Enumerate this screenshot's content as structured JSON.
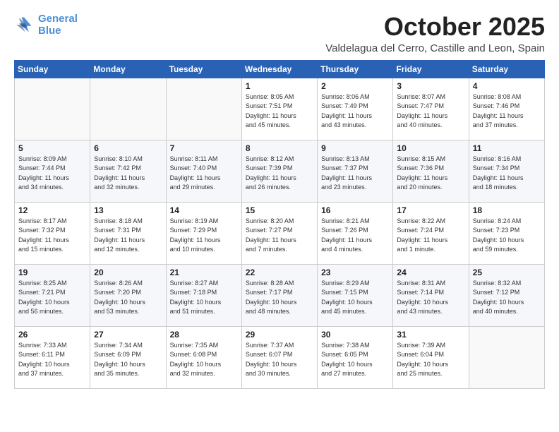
{
  "header": {
    "logo_line1": "General",
    "logo_line2": "Blue",
    "month": "October 2025",
    "location": "Valdelagua del Cerro, Castille and Leon, Spain"
  },
  "weekdays": [
    "Sunday",
    "Monday",
    "Tuesday",
    "Wednesday",
    "Thursday",
    "Friday",
    "Saturday"
  ],
  "weeks": [
    [
      {
        "day": "",
        "info": ""
      },
      {
        "day": "",
        "info": ""
      },
      {
        "day": "",
        "info": ""
      },
      {
        "day": "1",
        "info": "Sunrise: 8:05 AM\nSunset: 7:51 PM\nDaylight: 11 hours\nand 45 minutes."
      },
      {
        "day": "2",
        "info": "Sunrise: 8:06 AM\nSunset: 7:49 PM\nDaylight: 11 hours\nand 43 minutes."
      },
      {
        "day": "3",
        "info": "Sunrise: 8:07 AM\nSunset: 7:47 PM\nDaylight: 11 hours\nand 40 minutes."
      },
      {
        "day": "4",
        "info": "Sunrise: 8:08 AM\nSunset: 7:46 PM\nDaylight: 11 hours\nand 37 minutes."
      }
    ],
    [
      {
        "day": "5",
        "info": "Sunrise: 8:09 AM\nSunset: 7:44 PM\nDaylight: 11 hours\nand 34 minutes."
      },
      {
        "day": "6",
        "info": "Sunrise: 8:10 AM\nSunset: 7:42 PM\nDaylight: 11 hours\nand 32 minutes."
      },
      {
        "day": "7",
        "info": "Sunrise: 8:11 AM\nSunset: 7:40 PM\nDaylight: 11 hours\nand 29 minutes."
      },
      {
        "day": "8",
        "info": "Sunrise: 8:12 AM\nSunset: 7:39 PM\nDaylight: 11 hours\nand 26 minutes."
      },
      {
        "day": "9",
        "info": "Sunrise: 8:13 AM\nSunset: 7:37 PM\nDaylight: 11 hours\nand 23 minutes."
      },
      {
        "day": "10",
        "info": "Sunrise: 8:15 AM\nSunset: 7:36 PM\nDaylight: 11 hours\nand 20 minutes."
      },
      {
        "day": "11",
        "info": "Sunrise: 8:16 AM\nSunset: 7:34 PM\nDaylight: 11 hours\nand 18 minutes."
      }
    ],
    [
      {
        "day": "12",
        "info": "Sunrise: 8:17 AM\nSunset: 7:32 PM\nDaylight: 11 hours\nand 15 minutes."
      },
      {
        "day": "13",
        "info": "Sunrise: 8:18 AM\nSunset: 7:31 PM\nDaylight: 11 hours\nand 12 minutes."
      },
      {
        "day": "14",
        "info": "Sunrise: 8:19 AM\nSunset: 7:29 PM\nDaylight: 11 hours\nand 10 minutes."
      },
      {
        "day": "15",
        "info": "Sunrise: 8:20 AM\nSunset: 7:27 PM\nDaylight: 11 hours\nand 7 minutes."
      },
      {
        "day": "16",
        "info": "Sunrise: 8:21 AM\nSunset: 7:26 PM\nDaylight: 11 hours\nand 4 minutes."
      },
      {
        "day": "17",
        "info": "Sunrise: 8:22 AM\nSunset: 7:24 PM\nDaylight: 11 hours\nand 1 minute."
      },
      {
        "day": "18",
        "info": "Sunrise: 8:24 AM\nSunset: 7:23 PM\nDaylight: 10 hours\nand 59 minutes."
      }
    ],
    [
      {
        "day": "19",
        "info": "Sunrise: 8:25 AM\nSunset: 7:21 PM\nDaylight: 10 hours\nand 56 minutes."
      },
      {
        "day": "20",
        "info": "Sunrise: 8:26 AM\nSunset: 7:20 PM\nDaylight: 10 hours\nand 53 minutes."
      },
      {
        "day": "21",
        "info": "Sunrise: 8:27 AM\nSunset: 7:18 PM\nDaylight: 10 hours\nand 51 minutes."
      },
      {
        "day": "22",
        "info": "Sunrise: 8:28 AM\nSunset: 7:17 PM\nDaylight: 10 hours\nand 48 minutes."
      },
      {
        "day": "23",
        "info": "Sunrise: 8:29 AM\nSunset: 7:15 PM\nDaylight: 10 hours\nand 45 minutes."
      },
      {
        "day": "24",
        "info": "Sunrise: 8:31 AM\nSunset: 7:14 PM\nDaylight: 10 hours\nand 43 minutes."
      },
      {
        "day": "25",
        "info": "Sunrise: 8:32 AM\nSunset: 7:12 PM\nDaylight: 10 hours\nand 40 minutes."
      }
    ],
    [
      {
        "day": "26",
        "info": "Sunrise: 7:33 AM\nSunset: 6:11 PM\nDaylight: 10 hours\nand 37 minutes."
      },
      {
        "day": "27",
        "info": "Sunrise: 7:34 AM\nSunset: 6:09 PM\nDaylight: 10 hours\nand 35 minutes."
      },
      {
        "day": "28",
        "info": "Sunrise: 7:35 AM\nSunset: 6:08 PM\nDaylight: 10 hours\nand 32 minutes."
      },
      {
        "day": "29",
        "info": "Sunrise: 7:37 AM\nSunset: 6:07 PM\nDaylight: 10 hours\nand 30 minutes."
      },
      {
        "day": "30",
        "info": "Sunrise: 7:38 AM\nSunset: 6:05 PM\nDaylight: 10 hours\nand 27 minutes."
      },
      {
        "day": "31",
        "info": "Sunrise: 7:39 AM\nSunset: 6:04 PM\nDaylight: 10 hours\nand 25 minutes."
      },
      {
        "day": "",
        "info": ""
      }
    ]
  ]
}
